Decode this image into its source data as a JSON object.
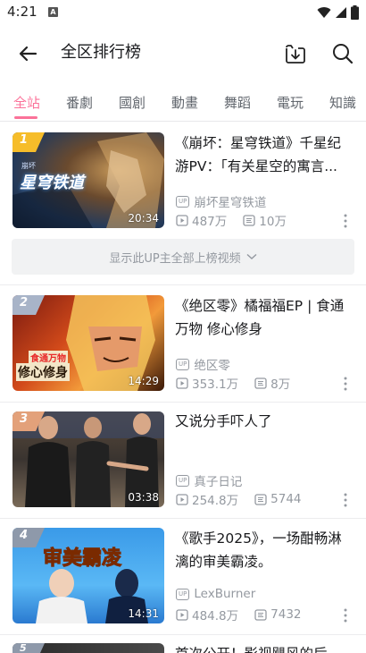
{
  "status_bar": {
    "time": "4:21",
    "notification": "A"
  },
  "header": {
    "title": "全区排行榜"
  },
  "tabs": [
    {
      "label": "全站",
      "active": true
    },
    {
      "label": "番劇",
      "active": false
    },
    {
      "label": "國創",
      "active": false
    },
    {
      "label": "動畫",
      "active": false
    },
    {
      "label": "舞蹈",
      "active": false
    },
    {
      "label": "電玩",
      "active": false
    },
    {
      "label": "知識",
      "active": false
    }
  ],
  "videos": [
    {
      "rank": "1",
      "title": "《崩坏：星穹铁道》千星纪游PV：「有关星空的寓言...",
      "up": "崩坏星穹铁道",
      "views": "487万",
      "danmaku": "10万",
      "duration": "20:34",
      "thumb_text": "星穹铁道",
      "thumb_sub": "崩坏",
      "badge_color": "#f6bd2a"
    },
    {
      "rank": "2",
      "title": "《绝区零》橘福福EP | 食通万物 修心修身",
      "up": "绝区零",
      "views": "353.1万",
      "danmaku": "8万",
      "duration": "14:29",
      "thumb_text": "修心修身",
      "thumb_sub": "食通万物",
      "badge_color": "#a8b4c8"
    },
    {
      "rank": "3",
      "title": "又说分手吓人了",
      "up": "真子日记",
      "views": "254.8万",
      "danmaku": "5744",
      "duration": "03:38",
      "badge_color": "#e3a17a"
    },
    {
      "rank": "4",
      "title": "《歌手2025》，一场酣畅淋漓的审美霸凌。",
      "up": "LexBurner",
      "views": "484.8万",
      "danmaku": "7432",
      "duration": "14:31",
      "thumb_text": "审美霸凌",
      "badge_color": "#8e99aa"
    },
    {
      "rank": "5",
      "title": "首次公开！影视飓风的后台...",
      "badge_color": "#8e99aa"
    }
  ],
  "show_all_label": "显示此UP主全部上榜视频",
  "up_tag": "UP",
  "colors": {
    "accent": "#fb7299",
    "muted": "#9499a0"
  }
}
